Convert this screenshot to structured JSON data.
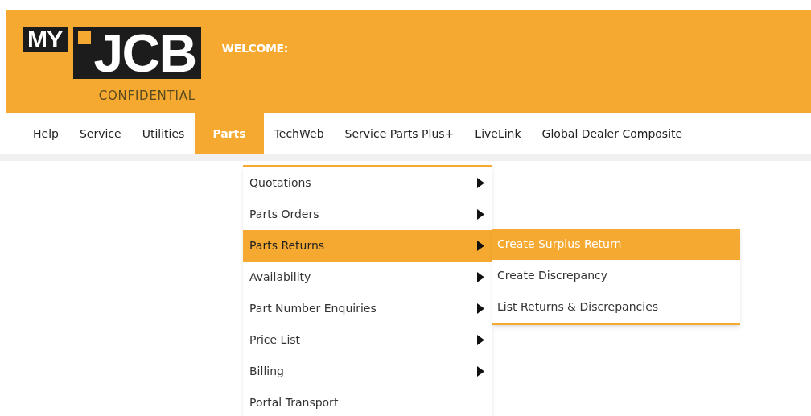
{
  "logo": {
    "prefix": "MY",
    "brand": "JCB",
    "tagline": "CONFIDENTIAL"
  },
  "welcome": "WELCOME:",
  "nav": [
    {
      "label": "Help",
      "selected": false
    },
    {
      "label": "Service",
      "selected": false
    },
    {
      "label": "Utilities",
      "selected": false
    },
    {
      "label": "Parts",
      "selected": true
    },
    {
      "label": "TechWeb",
      "selected": false
    },
    {
      "label": "Service Parts Plus+",
      "selected": false
    },
    {
      "label": "LiveLink",
      "selected": false
    },
    {
      "label": "Global Dealer Composite",
      "selected": false
    }
  ],
  "menu": [
    {
      "label": "Quotations",
      "selected": false,
      "submenu": true
    },
    {
      "label": "Parts Orders",
      "selected": false,
      "submenu": true
    },
    {
      "label": "Parts Returns",
      "selected": true,
      "submenu": true
    },
    {
      "label": "Availability",
      "selected": false,
      "submenu": true
    },
    {
      "label": "Part Number Enquiries",
      "selected": false,
      "submenu": true
    },
    {
      "label": "Price List",
      "selected": false,
      "submenu": true
    },
    {
      "label": "Billing",
      "selected": false,
      "submenu": true
    },
    {
      "label": "Portal Transport",
      "selected": false,
      "submenu": false
    }
  ],
  "submenu": [
    {
      "label": "Create Surplus Return",
      "selected": true
    },
    {
      "label": "Create Discrepancy",
      "selected": false
    },
    {
      "label": "List Returns & Discrepancies",
      "selected": false
    }
  ]
}
